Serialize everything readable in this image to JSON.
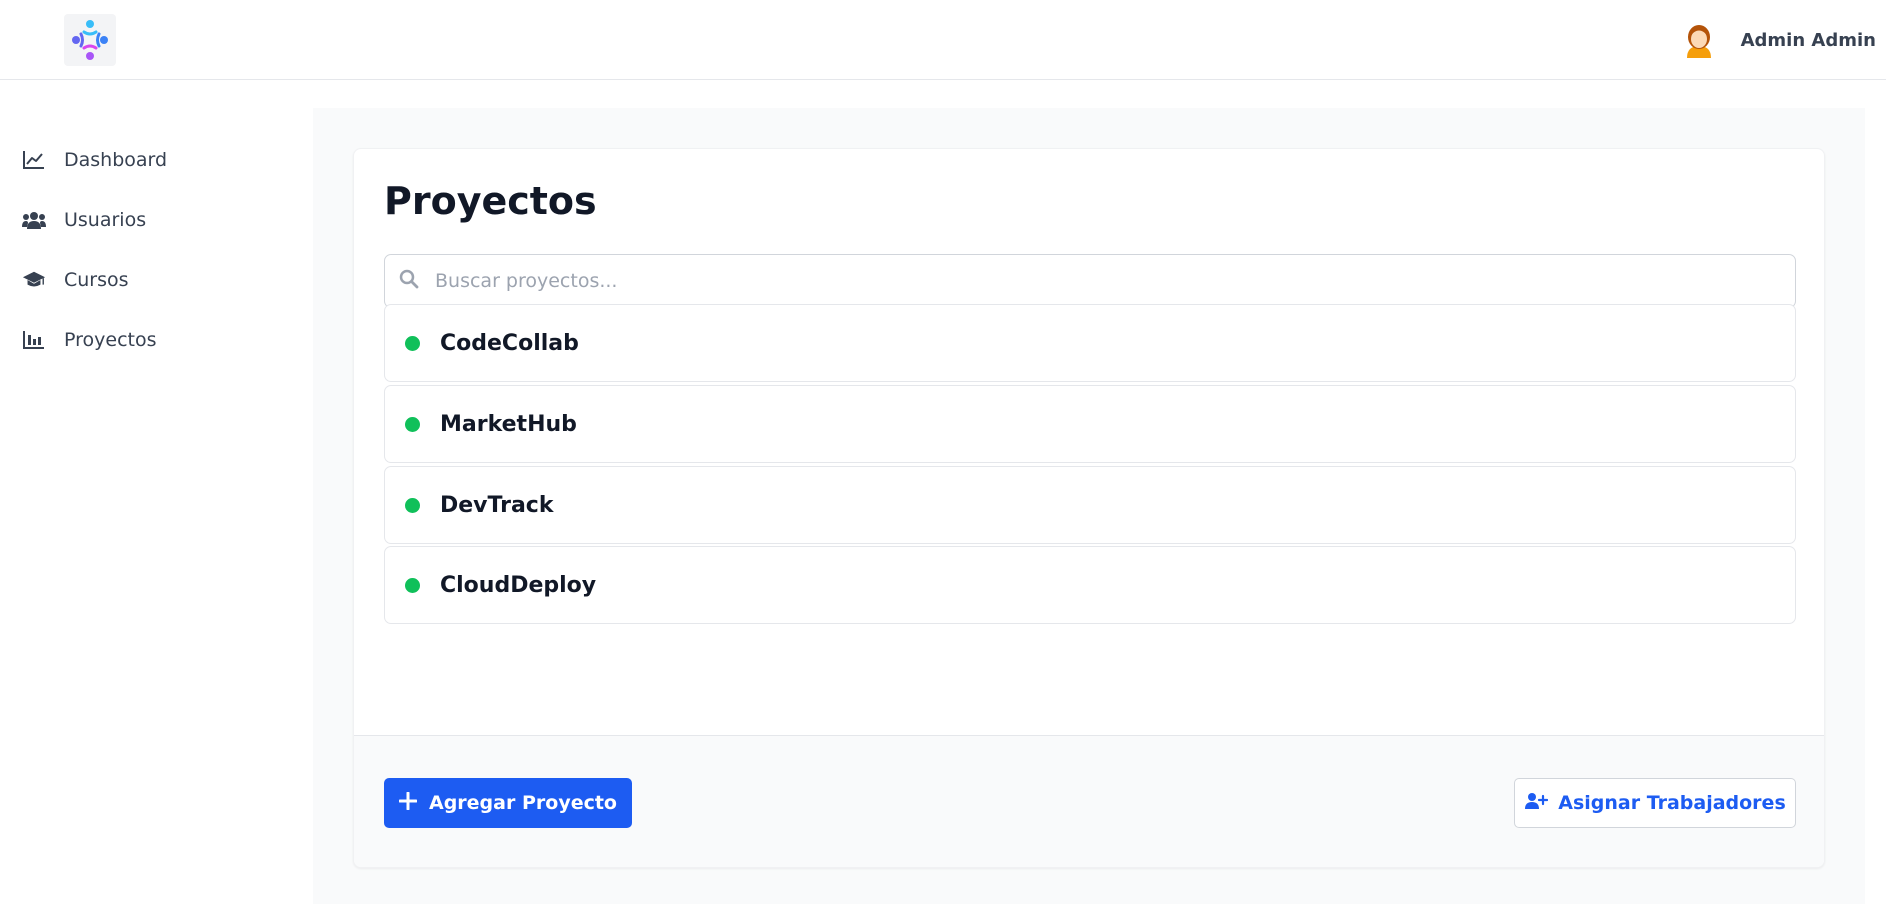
{
  "header": {
    "logo_icon": "people-network-logo",
    "user": {
      "name": "Admin Admin",
      "avatar_icon": "user-avatar-icon"
    }
  },
  "sidebar": {
    "items": [
      {
        "label": "Dashboard",
        "icon": "line-chart-icon"
      },
      {
        "label": "Usuarios",
        "icon": "users-icon"
      },
      {
        "label": "Cursos",
        "icon": "graduation-cap-icon"
      },
      {
        "label": "Proyectos",
        "icon": "bar-chart-icon"
      }
    ]
  },
  "main": {
    "title": "Proyectos",
    "search": {
      "placeholder": "Buscar proyectos...",
      "value": ""
    },
    "projects": [
      {
        "name": "CodeCollab",
        "status_color": "#10c05a"
      },
      {
        "name": "MarketHub",
        "status_color": "#10c05a"
      },
      {
        "name": "DevTrack",
        "status_color": "#10c05a"
      },
      {
        "name": "CloudDeploy",
        "status_color": "#10c05a"
      }
    ],
    "actions": {
      "add_label": "Agregar Proyecto",
      "assign_label": "Asignar Trabajadores"
    }
  },
  "colors": {
    "accent": "#1d5cf2",
    "status_active": "#10c05a",
    "background": "#f9fafb"
  }
}
